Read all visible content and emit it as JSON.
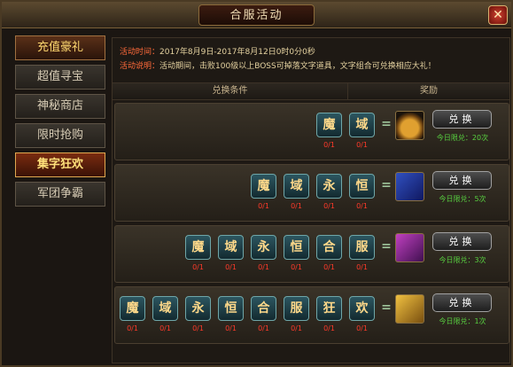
{
  "window": {
    "title": "合服活动"
  },
  "sidebar": {
    "items": [
      {
        "label": "充值豪礼"
      },
      {
        "label": "超值寻宝"
      },
      {
        "label": "神秘商店"
      },
      {
        "label": "限时抢购"
      },
      {
        "label": "集字狂欢"
      },
      {
        "label": "军团争霸"
      }
    ],
    "active_index": 4
  },
  "info": {
    "time_label": "活动时间：",
    "time_value": "2017年8月9日-2017年8月12日0时0分0秒",
    "desc_label": "活动说明：",
    "desc_value": "活动期间，击败100级以上BOSS可掉落文字道具，文字组合可兑换相应大礼！"
  },
  "table": {
    "col_condition": "兑换条件",
    "col_reward": "奖励"
  },
  "rows": [
    {
      "chars": [
        {
          "char": "魔",
          "count": "0/1"
        },
        {
          "char": "域",
          "count": "0/1"
        }
      ],
      "reward_icon": "gold-pouch-icon",
      "button": "兑换",
      "limit": "今日限兑：20次"
    },
    {
      "chars": [
        {
          "char": "魔",
          "count": "0/1"
        },
        {
          "char": "域",
          "count": "0/1"
        },
        {
          "char": "永",
          "count": "0/1"
        },
        {
          "char": "恒",
          "count": "0/1"
        }
      ],
      "reward_icon": "blue-chest-icon",
      "button": "兑换",
      "limit": "今日限兑：5次"
    },
    {
      "chars": [
        {
          "char": "魔",
          "count": "0/1"
        },
        {
          "char": "域",
          "count": "0/1"
        },
        {
          "char": "永",
          "count": "0/1"
        },
        {
          "char": "恒",
          "count": "0/1"
        },
        {
          "char": "合",
          "count": "0/1"
        },
        {
          "char": "服",
          "count": "0/1"
        }
      ],
      "reward_icon": "purple-chest-icon",
      "button": "兑换",
      "limit": "今日限兑：3次"
    },
    {
      "chars": [
        {
          "char": "魔",
          "count": "0/1"
        },
        {
          "char": "域",
          "count": "0/1"
        },
        {
          "char": "永",
          "count": "0/1"
        },
        {
          "char": "恒",
          "count": "0/1"
        },
        {
          "char": "合",
          "count": "0/1"
        },
        {
          "char": "服",
          "count": "0/1"
        },
        {
          "char": "狂",
          "count": "0/1"
        },
        {
          "char": "欢",
          "count": "0/1"
        }
      ],
      "reward_icon": "gold-chest-icon",
      "button": "兑换",
      "limit": "今日限兑：1次"
    }
  ]
}
